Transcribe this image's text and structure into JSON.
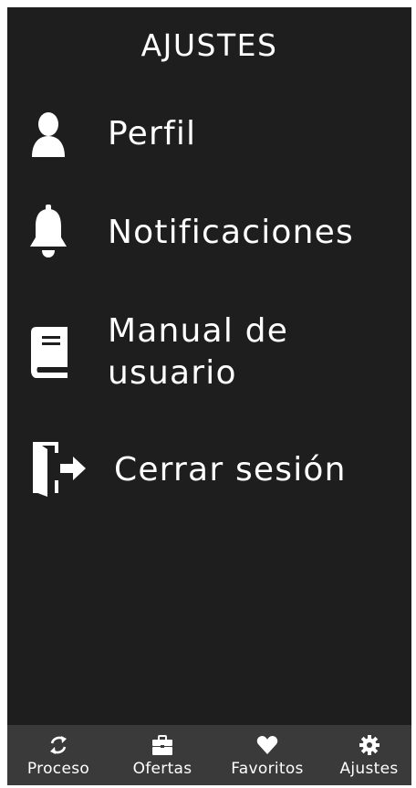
{
  "header": {
    "title": "AJUSTES"
  },
  "menu": {
    "items": [
      {
        "label": "Perfil",
        "icon": "user-icon"
      },
      {
        "label": "Notificaciones",
        "icon": "bell-icon"
      },
      {
        "label": "Manual de\nusuario",
        "icon": "book-icon"
      },
      {
        "label": "Cerrar sesión",
        "icon": "sign-out-icon"
      }
    ]
  },
  "tabbar": {
    "tabs": [
      {
        "label": "Proceso",
        "icon": "refresh-icon"
      },
      {
        "label": "Ofertas",
        "icon": "briefcase-icon"
      },
      {
        "label": "Favoritos",
        "icon": "heart-icon"
      },
      {
        "label": "Ajustes",
        "icon": "gear-icon",
        "active": true
      }
    ]
  },
  "colors": {
    "background": "#1e1e1e",
    "tabbar": "#3a3a3a",
    "text": "#ffffff"
  }
}
